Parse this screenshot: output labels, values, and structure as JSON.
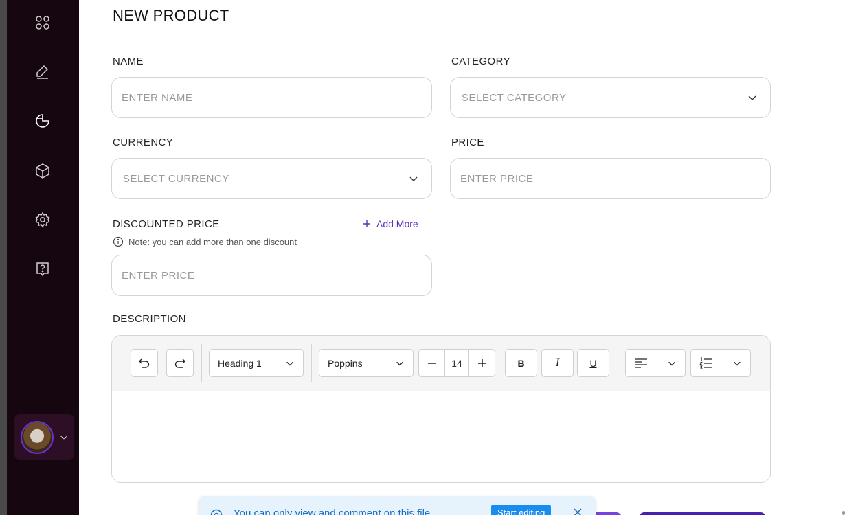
{
  "sidebar": {
    "icons": [
      "grid-icon",
      "edit-icon",
      "pie-chart-icon",
      "box-icon",
      "settings-icon",
      "help-icon"
    ],
    "profile_avatar": "avatar-image"
  },
  "form": {
    "title": "NEW PRODUCT",
    "name": {
      "label": "NAME",
      "placeholder": "ENTER NAME"
    },
    "category": {
      "label": "CATEGORY",
      "placeholder": "SELECT CATEGORY"
    },
    "currency": {
      "label": "CURRENCY",
      "placeholder": "SELECT CURRENCY"
    },
    "price": {
      "label": "PRICE",
      "placeholder": "ENTER PRICE"
    },
    "discounted_price": {
      "label": "DISCOUNTED PRICE",
      "add_more": "Add More",
      "note": "Note: you can add more than one discount",
      "placeholder": "ENTER PRICE"
    },
    "description": {
      "label": "DESCRIPTION"
    }
  },
  "editor": {
    "heading_select": "Heading 1",
    "font_select": "Poppins",
    "font_size": "14",
    "bold": "B",
    "italic": "I",
    "underline": "U"
  },
  "banner": {
    "text": "You can only view and comment on this file",
    "button": "Start editing"
  },
  "colors": {
    "sidebar_bg": "#160610",
    "accent": "#5b2fb8",
    "banner_bg": "#e6f2fc",
    "banner_button": "#1a8cf0"
  }
}
